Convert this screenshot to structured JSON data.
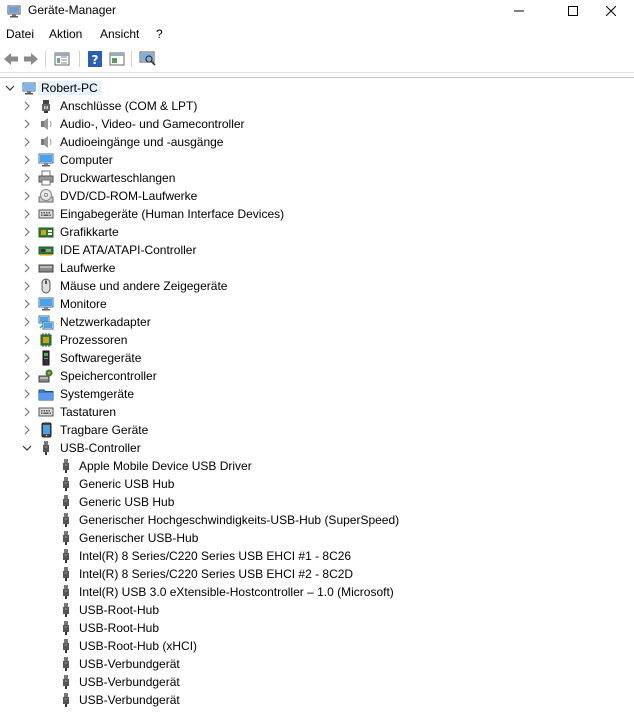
{
  "window": {
    "title": "Geräte-Manager"
  },
  "menu": [
    "Datei",
    "Aktion",
    "Ansicht",
    "?"
  ],
  "toolbar": {
    "buttons": [
      "back-icon",
      "forward-icon",
      "properties-icon",
      "help-icon",
      "show-hide-icon",
      "scan-hardware-icon"
    ]
  },
  "tree": {
    "root": "Robert-PC",
    "categories": [
      {
        "label": "Anschlüsse (COM & LPT)",
        "icon": "port-icon"
      },
      {
        "label": "Audio-, Video- und Gamecontroller",
        "icon": "speaker-icon"
      },
      {
        "label": "Audioeingänge und -ausgänge",
        "icon": "speaker-icon"
      },
      {
        "label": "Computer",
        "icon": "monitor-icon"
      },
      {
        "label": "Druckwarteschlangen",
        "icon": "printer-icon"
      },
      {
        "label": "DVD/CD-ROM-Laufwerke",
        "icon": "disc-icon"
      },
      {
        "label": "Eingabegeräte (Human Interface Devices)",
        "icon": "keyboard-icon"
      },
      {
        "label": "Grafikkarte",
        "icon": "graphics-card-icon"
      },
      {
        "label": "IDE ATA/ATAPI-Controller",
        "icon": "controller-card-icon"
      },
      {
        "label": "Laufwerke",
        "icon": "drive-icon"
      },
      {
        "label": "Mäuse und andere Zeigegeräte",
        "icon": "mouse-icon"
      },
      {
        "label": "Monitore",
        "icon": "monitor-icon"
      },
      {
        "label": "Netzwerkadapter",
        "icon": "network-icon"
      },
      {
        "label": "Prozessoren",
        "icon": "processor-icon"
      },
      {
        "label": "Softwaregeräte",
        "icon": "software-device-icon"
      },
      {
        "label": "Speichercontroller",
        "icon": "storage-controller-icon"
      },
      {
        "label": "Systemgeräte",
        "icon": "folder-icon"
      },
      {
        "label": "Tastaturen",
        "icon": "keyboard-icon"
      },
      {
        "label": "Tragbare Geräte",
        "icon": "portable-device-icon"
      },
      {
        "label": "USB-Controller",
        "icon": "usb-icon",
        "expanded": true
      }
    ],
    "usb_children": [
      "Apple Mobile Device USB Driver",
      "Generic USB Hub",
      "Generic USB Hub",
      "Generischer Hochgeschwindigkeits-USB-Hub (SuperSpeed)",
      "Generischer USB-Hub",
      "Intel(R) 8 Series/C220 Series USB EHCI #1 - 8C26",
      "Intel(R) 8 Series/C220 Series USB EHCI #2 - 8C2D",
      "Intel(R) USB 3.0 eXtensible-Hostcontroller – 1.0 (Microsoft)",
      "USB-Root-Hub",
      "USB-Root-Hub",
      "USB-Root-Hub (xHCI)",
      "USB-Verbundgerät",
      "USB-Verbundgerät",
      "USB-Verbundgerät"
    ]
  }
}
